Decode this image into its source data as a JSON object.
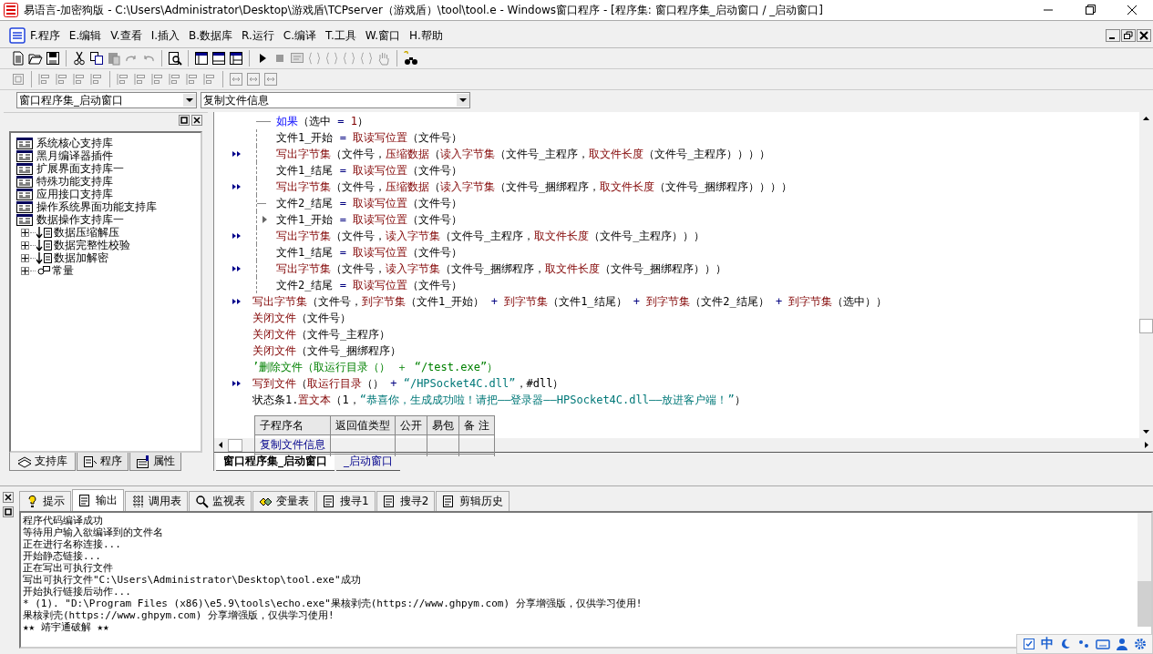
{
  "window": {
    "title": "易语言-加密狗版 - C:\\Users\\Administrator\\Desktop\\游戏盾\\TCPserver（游戏盾）\\tool\\tool.e - Windows窗口程序 - [程序集: 窗口程序集_启动窗口 / _启动窗口]"
  },
  "menu": [
    "F.程序",
    "E.编辑",
    "V.查看",
    "I.插入",
    "B.数据库",
    "R.运行",
    "C.编译",
    "T.工具",
    "W.窗口",
    "H.帮助"
  ],
  "selectors": [
    {
      "value": "窗口程序集_启动窗口"
    },
    {
      "value": "复制文件信息"
    }
  ],
  "library_panel": {
    "items": [
      {
        "label": "系统核心支持库",
        "kind": "library"
      },
      {
        "label": "黑月编译器插件",
        "kind": "library"
      },
      {
        "label": "扩展界面支持库一",
        "kind": "library"
      },
      {
        "label": "特殊功能支持库",
        "kind": "library"
      },
      {
        "label": "应用接口支持库",
        "kind": "library"
      },
      {
        "label": "操作系统界面功能支持库",
        "kind": "library"
      },
      {
        "label": "数据操作支持库一",
        "kind": "library",
        "children": [
          {
            "label": "数据压缩解压",
            "kind": "commands",
            "expanded": false
          },
          {
            "label": "数据完整性校验",
            "kind": "commands",
            "expanded": false
          },
          {
            "label": "数据加解密",
            "kind": "commands",
            "expanded": false
          },
          {
            "label": "常量",
            "kind": "constants",
            "expanded": false
          }
        ]
      }
    ],
    "tabs": [
      {
        "label": "支持库",
        "selected": true
      },
      {
        "label": "程序",
        "selected": false
      },
      {
        "label": "属性",
        "selected": false
      }
    ]
  },
  "editor": {
    "lines": [
      {
        "kind": "if",
        "marked": false,
        "segments": [
          {
            "text": "如果",
            "kind": "keyword"
          },
          {
            "text": "（选中 ",
            "kind": "plain"
          },
          {
            "text": "= ",
            "kind": "operator"
          },
          {
            "text": "1",
            "kind": "number"
          },
          {
            "text": "）",
            "kind": "plain"
          }
        ],
        "children": [
          {
            "kind": "statement",
            "marked": false,
            "segments": [
              {
                "text": "文件1_开始 ",
                "kind": "plain"
              },
              {
                "text": "= ",
                "kind": "operator"
              },
              {
                "text": "取读写位置",
                "kind": "function"
              },
              {
                "text": "（文件号）",
                "kind": "plain"
              }
            ]
          },
          {
            "kind": "statement",
            "marked": true,
            "segments": [
              {
                "text": "写出字节集",
                "kind": "function"
              },
              {
                "text": "（文件号，",
                "kind": "plain"
              },
              {
                "text": "压缩数据",
                "kind": "function"
              },
              {
                "text": "（",
                "kind": "plain"
              },
              {
                "text": "读入字节集",
                "kind": "function"
              },
              {
                "text": "（文件号_主程序，",
                "kind": "plain"
              },
              {
                "text": "取文件长度",
                "kind": "function"
              },
              {
                "text": "（文件号_主程序））））",
                "kind": "plain"
              }
            ]
          },
          {
            "kind": "statement",
            "marked": false,
            "segments": [
              {
                "text": "文件1_结尾 ",
                "kind": "plain"
              },
              {
                "text": "= ",
                "kind": "operator"
              },
              {
                "text": "取读写位置",
                "kind": "function"
              },
              {
                "text": "（文件号）",
                "kind": "plain"
              }
            ]
          },
          {
            "kind": "statement",
            "marked": true,
            "segments": [
              {
                "text": "写出字节集",
                "kind": "function"
              },
              {
                "text": "（文件号，",
                "kind": "plain"
              },
              {
                "text": "压缩数据",
                "kind": "function"
              },
              {
                "text": "（",
                "kind": "plain"
              },
              {
                "text": "读入字节集",
                "kind": "function"
              },
              {
                "text": "（文件号_捆绑程序，",
                "kind": "plain"
              },
              {
                "text": "取文件长度",
                "kind": "function"
              },
              {
                "text": "（文件号_捆绑程序））））",
                "kind": "plain"
              }
            ]
          },
          {
            "kind": "statement",
            "marked": false,
            "segments": [
              {
                "text": "文件2_结尾 ",
                "kind": "plain"
              },
              {
                "text": "= ",
                "kind": "operator"
              },
              {
                "text": "取读写位置",
                "kind": "function"
              },
              {
                "text": "（文件号）",
                "kind": "plain"
              }
            ]
          }
        ],
        "else_children": [
          {
            "kind": "statement",
            "marked": false,
            "segments": [
              {
                "text": "文件1_开始 ",
                "kind": "plain"
              },
              {
                "text": "= ",
                "kind": "operator"
              },
              {
                "text": "取读写位置",
                "kind": "function"
              },
              {
                "text": "（文件号）",
                "kind": "plain"
              }
            ]
          },
          {
            "kind": "statement",
            "marked": true,
            "segments": [
              {
                "text": "写出字节集",
                "kind": "function"
              },
              {
                "text": "（文件号，",
                "kind": "plain"
              },
              {
                "text": "读入字节集",
                "kind": "function"
              },
              {
                "text": "（文件号_主程序，",
                "kind": "plain"
              },
              {
                "text": "取文件长度",
                "kind": "function"
              },
              {
                "text": "（文件号_主程序）））",
                "kind": "plain"
              }
            ]
          },
          {
            "kind": "statement",
            "marked": false,
            "segments": [
              {
                "text": "文件1_结尾 ",
                "kind": "plain"
              },
              {
                "text": "= ",
                "kind": "operator"
              },
              {
                "text": "取读写位置",
                "kind": "function"
              },
              {
                "text": "（文件号）",
                "kind": "plain"
              }
            ]
          },
          {
            "kind": "statement",
            "marked": true,
            "segments": [
              {
                "text": "写出字节集",
                "kind": "function"
              },
              {
                "text": "（文件号，",
                "kind": "plain"
              },
              {
                "text": "读入字节集",
                "kind": "function"
              },
              {
                "text": "（文件号_捆绑程序，",
                "kind": "plain"
              },
              {
                "text": "取文件长度",
                "kind": "function"
              },
              {
                "text": "（文件号_捆绑程序）））",
                "kind": "plain"
              }
            ]
          },
          {
            "kind": "statement",
            "marked": false,
            "segments": [
              {
                "text": "文件2_结尾 ",
                "kind": "plain"
              },
              {
                "text": "= ",
                "kind": "operator"
              },
              {
                "text": "取读写位置",
                "kind": "function"
              },
              {
                "text": "（文件号）",
                "kind": "plain"
              }
            ]
          }
        ]
      },
      {
        "kind": "statement",
        "marked": true,
        "segments": [
          {
            "text": "写出字节集",
            "kind": "function"
          },
          {
            "text": "（文件号，",
            "kind": "plain"
          },
          {
            "text": "到字节集",
            "kind": "function"
          },
          {
            "text": "（文件1_开始） ",
            "kind": "plain"
          },
          {
            "text": "+ ",
            "kind": "operator"
          },
          {
            "text": "到字节集",
            "kind": "function"
          },
          {
            "text": "（文件1_结尾） ",
            "kind": "plain"
          },
          {
            "text": "+ ",
            "kind": "operator"
          },
          {
            "text": "到字节集",
            "kind": "function"
          },
          {
            "text": "（文件2_结尾） ",
            "kind": "plain"
          },
          {
            "text": "+ ",
            "kind": "operator"
          },
          {
            "text": "到字节集",
            "kind": "function"
          },
          {
            "text": "（选中））",
            "kind": "plain"
          }
        ]
      },
      {
        "kind": "statement",
        "marked": false,
        "segments": [
          {
            "text": "关闭文件",
            "kind": "function"
          },
          {
            "text": "（文件号）",
            "kind": "plain"
          }
        ]
      },
      {
        "kind": "statement",
        "marked": false,
        "segments": [
          {
            "text": "关闭文件",
            "kind": "function"
          },
          {
            "text": "（文件号_主程序）",
            "kind": "plain"
          }
        ]
      },
      {
        "kind": "statement",
        "marked": false,
        "segments": [
          {
            "text": "关闭文件",
            "kind": "function"
          },
          {
            "text": "（文件号_捆绑程序）",
            "kind": "plain"
          }
        ]
      },
      {
        "kind": "comment",
        "marked": false,
        "segments": [
          {
            "text": "’删除文件（取运行目录（） ＋ “/test.exe”）",
            "kind": "comment"
          }
        ]
      },
      {
        "kind": "statement",
        "marked": true,
        "segments": [
          {
            "text": "写到文件",
            "kind": "function"
          },
          {
            "text": "（",
            "kind": "plain"
          },
          {
            "text": "取运行目录",
            "kind": "function"
          },
          {
            "text": "（） ",
            "kind": "plain"
          },
          {
            "text": "+ ",
            "kind": "operator"
          },
          {
            "text": "“/HPSocket4C.dll”",
            "kind": "string"
          },
          {
            "text": "，#dll）",
            "kind": "plain"
          }
        ]
      },
      {
        "kind": "statement",
        "marked": false,
        "segments": [
          {
            "text": "状态条1.",
            "kind": "plain"
          },
          {
            "text": "置文本",
            "kind": "function"
          },
          {
            "text": "（1，",
            "kind": "plain"
          },
          {
            "text": "“恭喜你，生成成功啦！请把——登录器——HPSocket4C.dll——放进客户端！”",
            "kind": "string"
          },
          {
            "text": "）",
            "kind": "plain"
          }
        ]
      }
    ],
    "sub_table": {
      "columns": [
        "子程序名",
        "返回值类型",
        "公开",
        "易包",
        "备 注"
      ],
      "rows": [
        [
          "复制文件信息",
          "",
          "",
          "",
          ""
        ]
      ]
    },
    "tabs": [
      {
        "label": "窗口程序集_启动窗口",
        "selected": true
      },
      {
        "label": "_启动窗口",
        "selected": false
      }
    ]
  },
  "output_panel": {
    "tabs": [
      {
        "label": "提示",
        "selected": false
      },
      {
        "label": "输出",
        "selected": true
      },
      {
        "label": "调用表",
        "selected": false
      },
      {
        "label": "监视表",
        "selected": false
      },
      {
        "label": "变量表",
        "selected": false
      },
      {
        "label": "搜寻1",
        "selected": false
      },
      {
        "label": "搜寻2",
        "selected": false
      },
      {
        "label": "剪辑历史",
        "selected": false
      }
    ],
    "lines": [
      "程序代码编译成功",
      "等待用户输入欲编译到的文件名",
      "正在进行名称连接...",
      "开始静态链接...",
      "正在写出可执行文件",
      "写出可执行文件\"C:\\Users\\Administrator\\Desktop\\tool.exe\"成功",
      "开始执行链接后动作...",
      "* (1). \"D:\\Program Files (x86)\\e5.9\\tools\\echo.exe\"果核剥壳(https://www.ghpym.com) 分享增强版，仅供学习使用!",
      "果核剥壳(https://www.ghpym.com) 分享增强版，仅供学习使用!",
      "★★ 靖宇通破解 ★★"
    ]
  },
  "tray": {
    "ime_mode": "中"
  }
}
